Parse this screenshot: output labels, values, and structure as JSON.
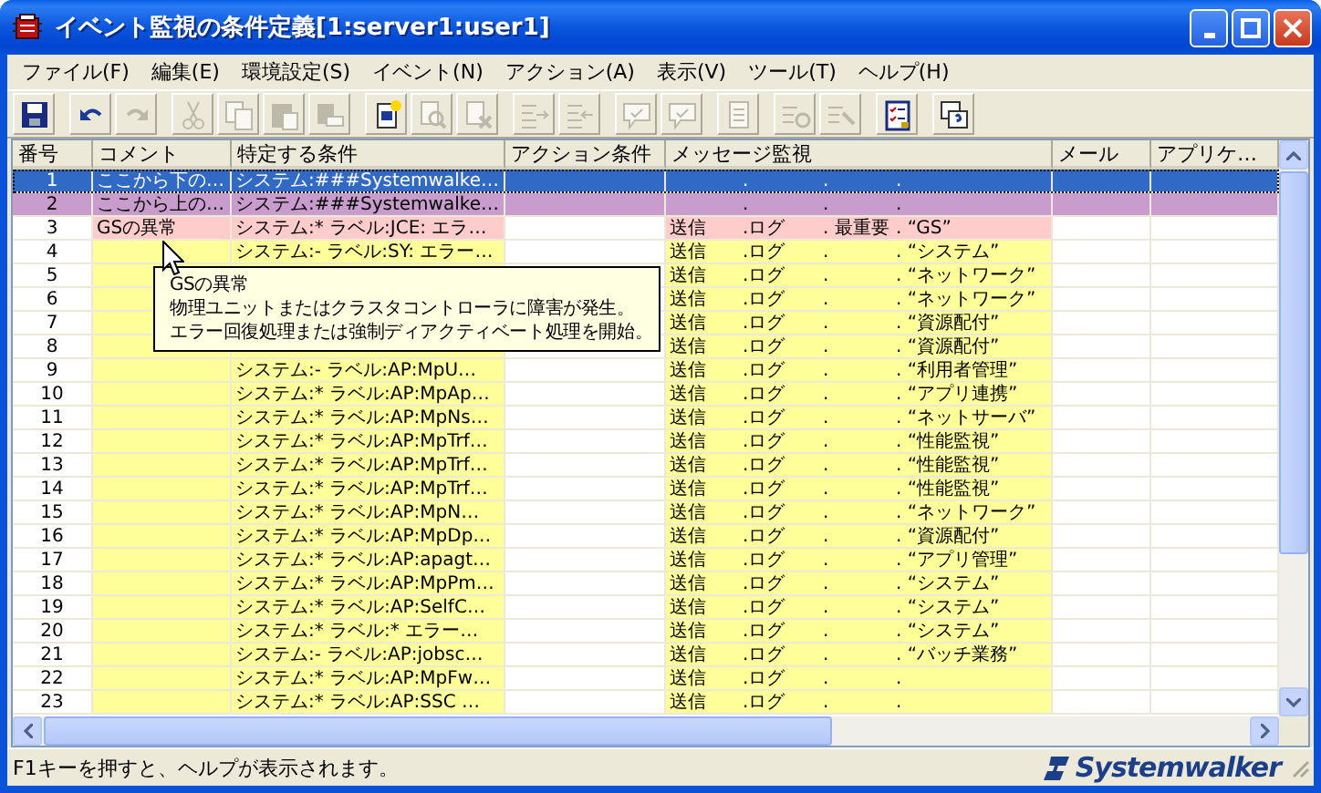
{
  "window": {
    "title": "イベント監視の条件定義[1:server1:user1]"
  },
  "menu": [
    "ファイル(F)",
    "編集(E)",
    "環境設定(S)",
    "イベント(N)",
    "アクション(A)",
    "表示(V)",
    "ツール(T)",
    "ヘルプ(H)"
  ],
  "toolbar": [
    {
      "disabled": false
    },
    {
      "disabled": false
    },
    {
      "disabled": true
    },
    {
      "disabled": true
    },
    {
      "disabled": true
    },
    {
      "disabled": true
    },
    {
      "disabled": true
    },
    {
      "disabled": false
    },
    {
      "disabled": true
    },
    {
      "disabled": true
    },
    {
      "disabled": true
    },
    {
      "disabled": true
    },
    {
      "disabled": true
    },
    {
      "disabled": true
    },
    {
      "disabled": true
    },
    {
      "disabled": true
    },
    {
      "disabled": true
    },
    {
      "disabled": false
    },
    {
      "disabled": false
    }
  ],
  "table": {
    "columns": [
      "番号",
      "コメント",
      "特定する条件",
      "アクション条件",
      "メッセージ監視",
      "メール",
      "アプリケ…"
    ],
    "rows": [
      {
        "no": "1",
        "kind": "full",
        "selected": true,
        "comment": "ここから下の…",
        "condition": "システム:###Systemwalke…",
        "message": {
          "log": ".",
          "priority": ".",
          "text": "."
        }
      },
      {
        "no": "2",
        "kind": "full",
        "selected": false,
        "color": "#c89ccc",
        "comment": "ここから上の…",
        "condition": "システム:###Systemwalke…",
        "message": {
          "log": ".",
          "priority": ".",
          "text": "."
        }
      },
      {
        "no": "3",
        "kind": "cells",
        "selected": false,
        "color": "#ffcccc",
        "comment": "GSの異常",
        "condition": "システム:* ラベル:JCE: エラ…",
        "message": {
          "send": "送信",
          "log": ".ログ",
          "priority": ". 最重要",
          "text": ". “GS”"
        }
      },
      {
        "no": "4",
        "kind": "cells",
        "selected": false,
        "color": "#ffff99",
        "condition": "システム:- ラベル:SY: エラー…",
        "message": {
          "send": "送信",
          "log": ".ログ",
          "priority": ".",
          "text": ". “システム”"
        }
      },
      {
        "no": "5",
        "kind": "cells",
        "selected": false,
        "color": "#ffff99",
        "message": {
          "send": "送信",
          "log": ".ログ",
          "priority": ".",
          "text": ". “ネットワーク”"
        }
      },
      {
        "no": "6",
        "kind": "cells",
        "selected": false,
        "color": "#ffff99",
        "message": {
          "send": "送信",
          "log": ".ログ",
          "priority": ".",
          "text": ". “ネットワーク”"
        }
      },
      {
        "no": "7",
        "kind": "cells",
        "selected": false,
        "color": "#ffff99",
        "message": {
          "send": "送信",
          "log": ".ログ",
          "priority": ".",
          "text": ". “資源配付”"
        }
      },
      {
        "no": "8",
        "kind": "cells",
        "selected": false,
        "color": "#ffff99",
        "message": {
          "send": "送信",
          "log": ".ログ",
          "priority": ".",
          "text": ". “資源配付”"
        }
      },
      {
        "no": "9",
        "kind": "cells",
        "selected": false,
        "color": "#ffff99",
        "condition": "システム:- ラベル:AP:MpU…",
        "message": {
          "send": "送信",
          "log": ".ログ",
          "priority": ".",
          "text": ". “利用者管理”"
        }
      },
      {
        "no": "10",
        "kind": "cells",
        "selected": false,
        "color": "#ffff99",
        "condition": "システム:* ラベル:AP:MpAp…",
        "message": {
          "send": "送信",
          "log": ".ログ",
          "priority": ".",
          "text": ". “アプリ連携”"
        }
      },
      {
        "no": "11",
        "kind": "cells",
        "selected": false,
        "color": "#ffff99",
        "condition": "システム:* ラベル:AP:MpNs…",
        "message": {
          "send": "送信",
          "log": ".ログ",
          "priority": ".",
          "text": ". “ネットサーバ”"
        }
      },
      {
        "no": "12",
        "kind": "cells",
        "selected": false,
        "color": "#ffff99",
        "condition": "システム:* ラベル:AP:MpTrf…",
        "message": {
          "send": "送信",
          "log": ".ログ",
          "priority": ".",
          "text": ". “性能監視”"
        }
      },
      {
        "no": "13",
        "kind": "cells",
        "selected": false,
        "color": "#ffff99",
        "condition": "システム:* ラベル:AP:MpTrf…",
        "message": {
          "send": "送信",
          "log": ".ログ",
          "priority": ".",
          "text": ". “性能監視”"
        }
      },
      {
        "no": "14",
        "kind": "cells",
        "selected": false,
        "color": "#ffff99",
        "condition": "システム:* ラベル:AP:MpTrf…",
        "message": {
          "send": "送信",
          "log": ".ログ",
          "priority": ".",
          "text": ". “性能監視”"
        }
      },
      {
        "no": "15",
        "kind": "cells",
        "selected": false,
        "color": "#ffff99",
        "condition": "システム:* ラベル:AP:MpN…",
        "message": {
          "send": "送信",
          "log": ".ログ",
          "priority": ".",
          "text": ". “ネットワーク”"
        }
      },
      {
        "no": "16",
        "kind": "cells",
        "selected": false,
        "color": "#ffff99",
        "condition": "システム:* ラベル:AP:MpDp…",
        "message": {
          "send": "送信",
          "log": ".ログ",
          "priority": ".",
          "text": ". “資源配付”"
        }
      },
      {
        "no": "17",
        "kind": "cells",
        "selected": false,
        "color": "#ffff99",
        "condition": "システム:* ラベル:AP:apagt…",
        "message": {
          "send": "送信",
          "log": ".ログ",
          "priority": ".",
          "text": ". “アプリ管理”"
        }
      },
      {
        "no": "18",
        "kind": "cells",
        "selected": false,
        "color": "#ffff99",
        "condition": "システム:* ラベル:AP:MpPm…",
        "message": {
          "send": "送信",
          "log": ".ログ",
          "priority": ".",
          "text": ". “システム”"
        }
      },
      {
        "no": "19",
        "kind": "cells",
        "selected": false,
        "color": "#ffff99",
        "condition": "システム:* ラベル:AP:SelfC…",
        "message": {
          "send": "送信",
          "log": ".ログ",
          "priority": ".",
          "text": ". “システム”"
        }
      },
      {
        "no": "20",
        "kind": "cells",
        "selected": false,
        "color": "#ffff99",
        "condition": "システム:* ラベル:* エラー…",
        "message": {
          "send": "送信",
          "log": ".ログ",
          "priority": ".",
          "text": ". “システム”"
        }
      },
      {
        "no": "21",
        "kind": "cells",
        "selected": false,
        "color": "#ffff99",
        "condition": "システム:- ラベル:AP:jobsc…",
        "message": {
          "send": "送信",
          "log": ".ログ",
          "priority": ".",
          "text": ". “バッチ業務”"
        }
      },
      {
        "no": "22",
        "kind": "cells",
        "selected": false,
        "color": "#ffff99",
        "condition": "システム:* ラベル:AP:MpFw…",
        "message": {
          "send": "送信",
          "log": ".ログ",
          "priority": ".",
          "text": "."
        }
      },
      {
        "no": "23",
        "kind": "cells",
        "selected": false,
        "color": "#ffff99",
        "condition": "システム:* ラベル:AP:SSC …",
        "message": {
          "send": "送信",
          "log": ".ログ",
          "priority": ".",
          "text": "."
        }
      }
    ]
  },
  "tooltip": {
    "lines": [
      "GSの異常",
      "物理ユニットまたはクラスタコントローラに障害が発生。",
      "エラー回復処理または強制ディアクティベート処理を開始。"
    ]
  },
  "status_bar": {
    "text": "F1キーを押すと、ヘルプが表示されます。",
    "logo": "Systemwalker"
  }
}
